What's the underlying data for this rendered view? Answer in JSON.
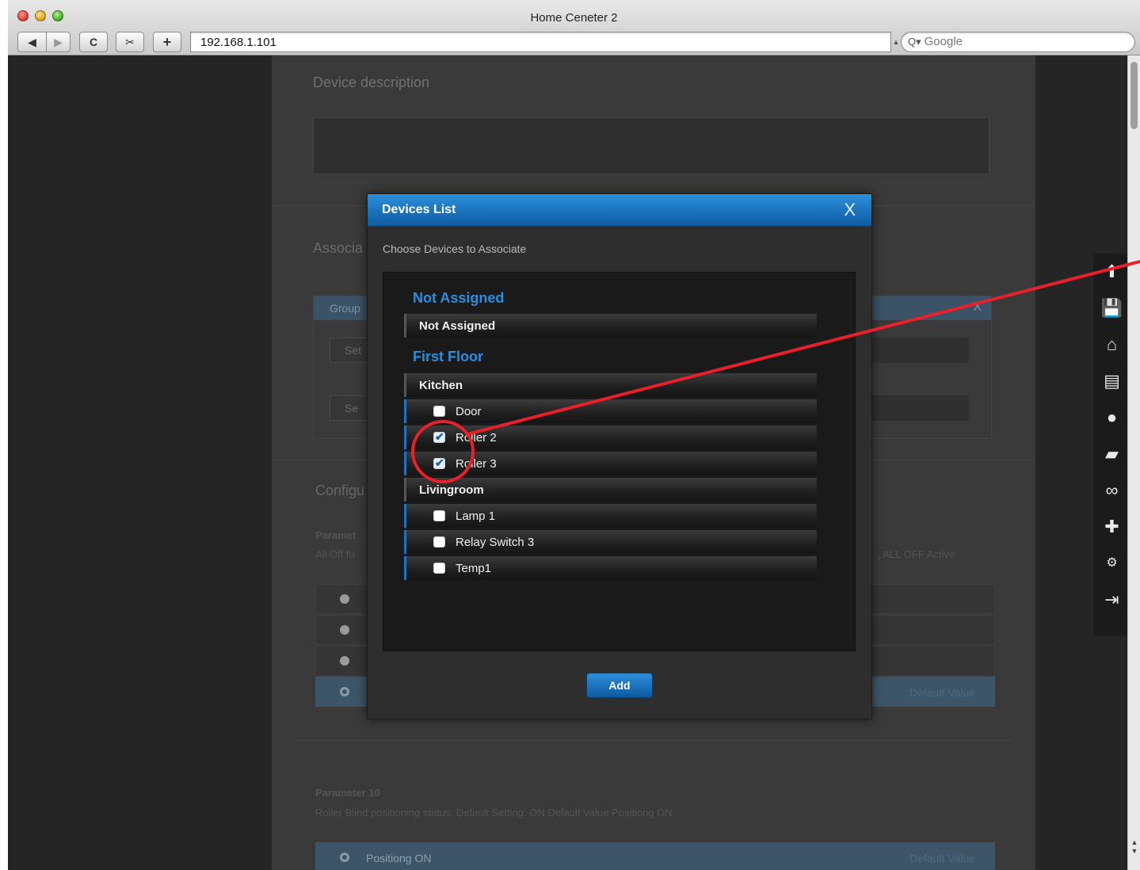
{
  "window": {
    "title": "Home Ceneter 2"
  },
  "toolbar": {
    "back": "◀",
    "forward": "▶",
    "reload": "C",
    "snip": "✂",
    "new_tab": "+",
    "address": "192.168.1.101",
    "search_placeholder": "Google"
  },
  "page": {
    "device_description_label": "Device description",
    "associations_label": "Associa",
    "group_label": "Group",
    "group_close": "X",
    "set_buttons": [
      "Set",
      "Se"
    ],
    "configuration_label": "Configu",
    "param_partial_title": "Paramet",
    "param_partial_desc": "All Off fu",
    "param_partial_tail": ", ALL OFF Active",
    "default_value_label": "Default Value",
    "parameter10": {
      "title": "Parameter 10",
      "desc": "Roller Blind positioning status. Default Setting: ON Default Value Positiong ON",
      "option_label": "Positiong ON",
      "option_default": "Default Value"
    }
  },
  "sidebar_tools": [
    "up-arrow-icon",
    "floppy-icon",
    "house-icon",
    "panel-icon",
    "bulb-icon",
    "scene-clapper-icon",
    "link-icon",
    "plugin-icon",
    "gears-icon",
    "logout-icon"
  ],
  "modal": {
    "title": "Devices List",
    "close": "X",
    "subtitle": "Choose Devices to Associate",
    "sections": [
      {
        "name": "Not Assigned",
        "rooms": [
          {
            "name": "Not Assigned",
            "devices": []
          }
        ]
      },
      {
        "name": "First Floor",
        "rooms": [
          {
            "name": "Kitchen",
            "devices": [
              {
                "name": "Door",
                "checked": false
              },
              {
                "name": "Roller 2",
                "checked": true
              },
              {
                "name": "Roller 3",
                "checked": true
              }
            ]
          },
          {
            "name": "Livingroom",
            "devices": [
              {
                "name": "Lamp 1",
                "checked": false
              },
              {
                "name": "Relay Switch 3",
                "checked": false
              },
              {
                "name": "Temp1",
                "checked": false
              }
            ]
          }
        ]
      }
    ],
    "add_label": "Add"
  },
  "colors": {
    "accent": "#2a8ee0",
    "header": "#1a72c0",
    "annotation": "#e8202a"
  }
}
